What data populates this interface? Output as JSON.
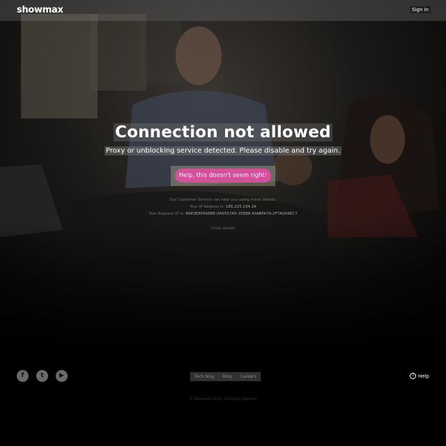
{
  "header": {
    "logo": "showmax",
    "signin_label": "Sign in"
  },
  "main": {
    "title": "Connection not allowed",
    "subtitle": "Proxy or unblocking service detected. Please disable and try again.",
    "help_button": "Help, this doesn't seem right!",
    "info_line1": "Our Customer Service can help you using these details.",
    "ip_label": "Your IP Address is:",
    "ip_value": "185.225.234.26",
    "request_label": "Your Request ID is:",
    "request_value": "B4E3EAY6A6BE-0A5557A5-35EB8.43ABFA7A-2F7A0A9EC7",
    "close_label": "Close details"
  },
  "footer": {
    "social_icons": [
      "facebook-icon",
      "twitter-icon",
      "youtube-icon"
    ],
    "links": [
      "Tech blog",
      "Blog",
      "Careers"
    ],
    "help_label": "Help",
    "copyright": "© Showmax 2024 · All rights reserved"
  },
  "colors": {
    "accent": "#d5509a",
    "background": "#000000"
  }
}
